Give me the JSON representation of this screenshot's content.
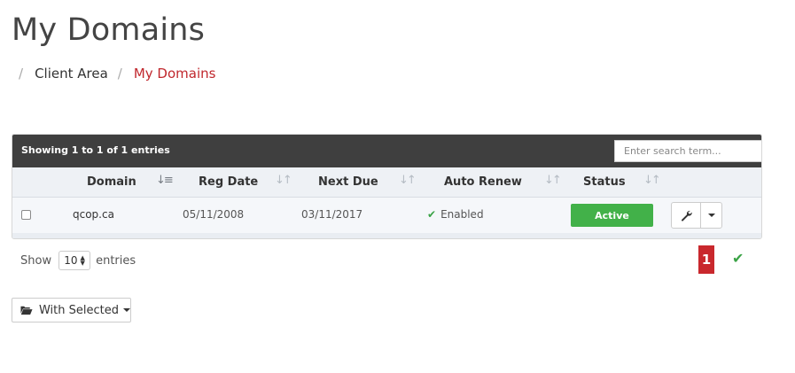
{
  "page": {
    "title": "My Domains"
  },
  "breadcrumb": {
    "items": [
      "Client Area",
      "My Domains"
    ],
    "separator": "/"
  },
  "table": {
    "info_text": "Showing 1 to 1 of 1 entries",
    "search_placeholder": "Enter search term...",
    "columns": [
      "Domain",
      "Reg Date",
      "Next Due",
      "Auto Renew",
      "Status"
    ],
    "rows": [
      {
        "domain": "qcop.ca",
        "reg_date": "05/11/2008",
        "next_due": "03/11/2017",
        "auto_renew": "Enabled",
        "status": "Active"
      }
    ],
    "length": {
      "label_prefix": "Show",
      "value": "10",
      "label_suffix": "entries"
    }
  },
  "pagination": {
    "current_page": "1"
  },
  "bulk_actions": {
    "label": "With Selected"
  },
  "colors": {
    "header_bg": "#3f3f3f",
    "accent_red": "#c9282d",
    "status_green": "#42b149",
    "check_green": "#3aa346"
  },
  "icons": [
    "sort-icon",
    "checkmark-icon",
    "wrench-icon",
    "caret-down-icon",
    "folder-open-icon"
  ]
}
